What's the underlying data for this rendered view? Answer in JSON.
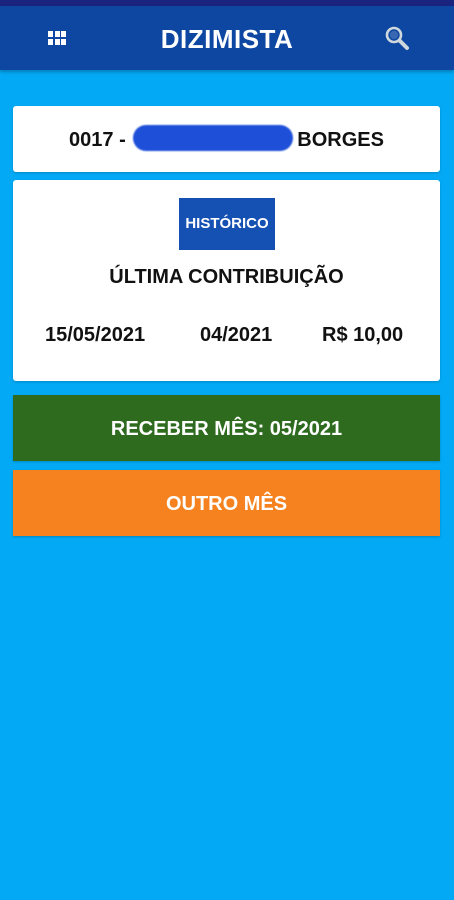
{
  "app_bar": {
    "title": "DIZIMISTA",
    "menu_icon": "grid-icon",
    "search_icon": "search-icon",
    "background_color": "#0d47a1"
  },
  "member": {
    "code_prefix": "0017 - ",
    "surname": "BORGES"
  },
  "history": {
    "button_label": "HISTÓRICO",
    "section_title": "ÚLTIMA CONTRIBUIÇÃO",
    "last_contribution": {
      "date": "15/05/2021",
      "reference_month": "04/2021",
      "amount": "R$ 10,00"
    }
  },
  "actions": {
    "receive_label": "RECEBER MÊS: 05/2021",
    "receive_color": "#2e6b1f",
    "other_month_label": "OUTRO MÊS",
    "other_month_color": "#f5821f"
  },
  "colors": {
    "page_background": "#03a9f4",
    "history_button": "#1451b3"
  }
}
